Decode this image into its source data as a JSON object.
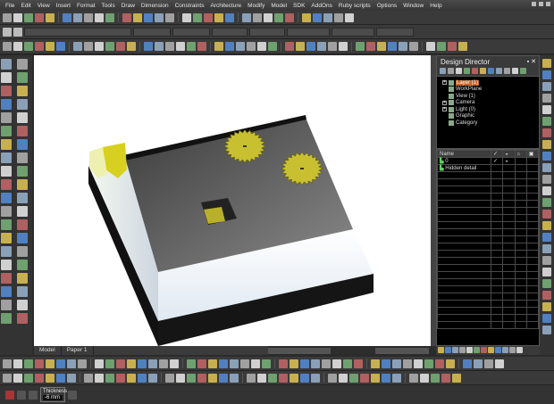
{
  "menu": [
    "File",
    "Edit",
    "View",
    "Insert",
    "Format",
    "Tools",
    "Draw",
    "Dimension",
    "Constraints",
    "Architecture",
    "Modify",
    "Model",
    "SDK",
    "AddOns",
    "Ruby scripts",
    "Options",
    "Window",
    "Help"
  ],
  "design_director": {
    "title": "Design Director",
    "tree": [
      {
        "label": "Layer (1)",
        "expand": true,
        "selected": true
      },
      {
        "label": "WorkPlane",
        "expand": false
      },
      {
        "label": "View (1)",
        "expand": false
      },
      {
        "label": "Camera",
        "expand": true
      },
      {
        "label": "Light (0)",
        "expand": true
      },
      {
        "label": "Graphic",
        "expand": false
      },
      {
        "label": "Category",
        "expand": false
      }
    ],
    "table_header": "Name",
    "rows": [
      "0",
      "Hidden detail"
    ]
  },
  "tabs": [
    "Model",
    "Paper 1"
  ],
  "status": {
    "thickness_label": "Thickness",
    "thickness_value": "-6 mm"
  },
  "colors": {
    "accent_yellow": "#c8c030",
    "background": "#2b2b2b",
    "viewport": "#ffffff"
  }
}
